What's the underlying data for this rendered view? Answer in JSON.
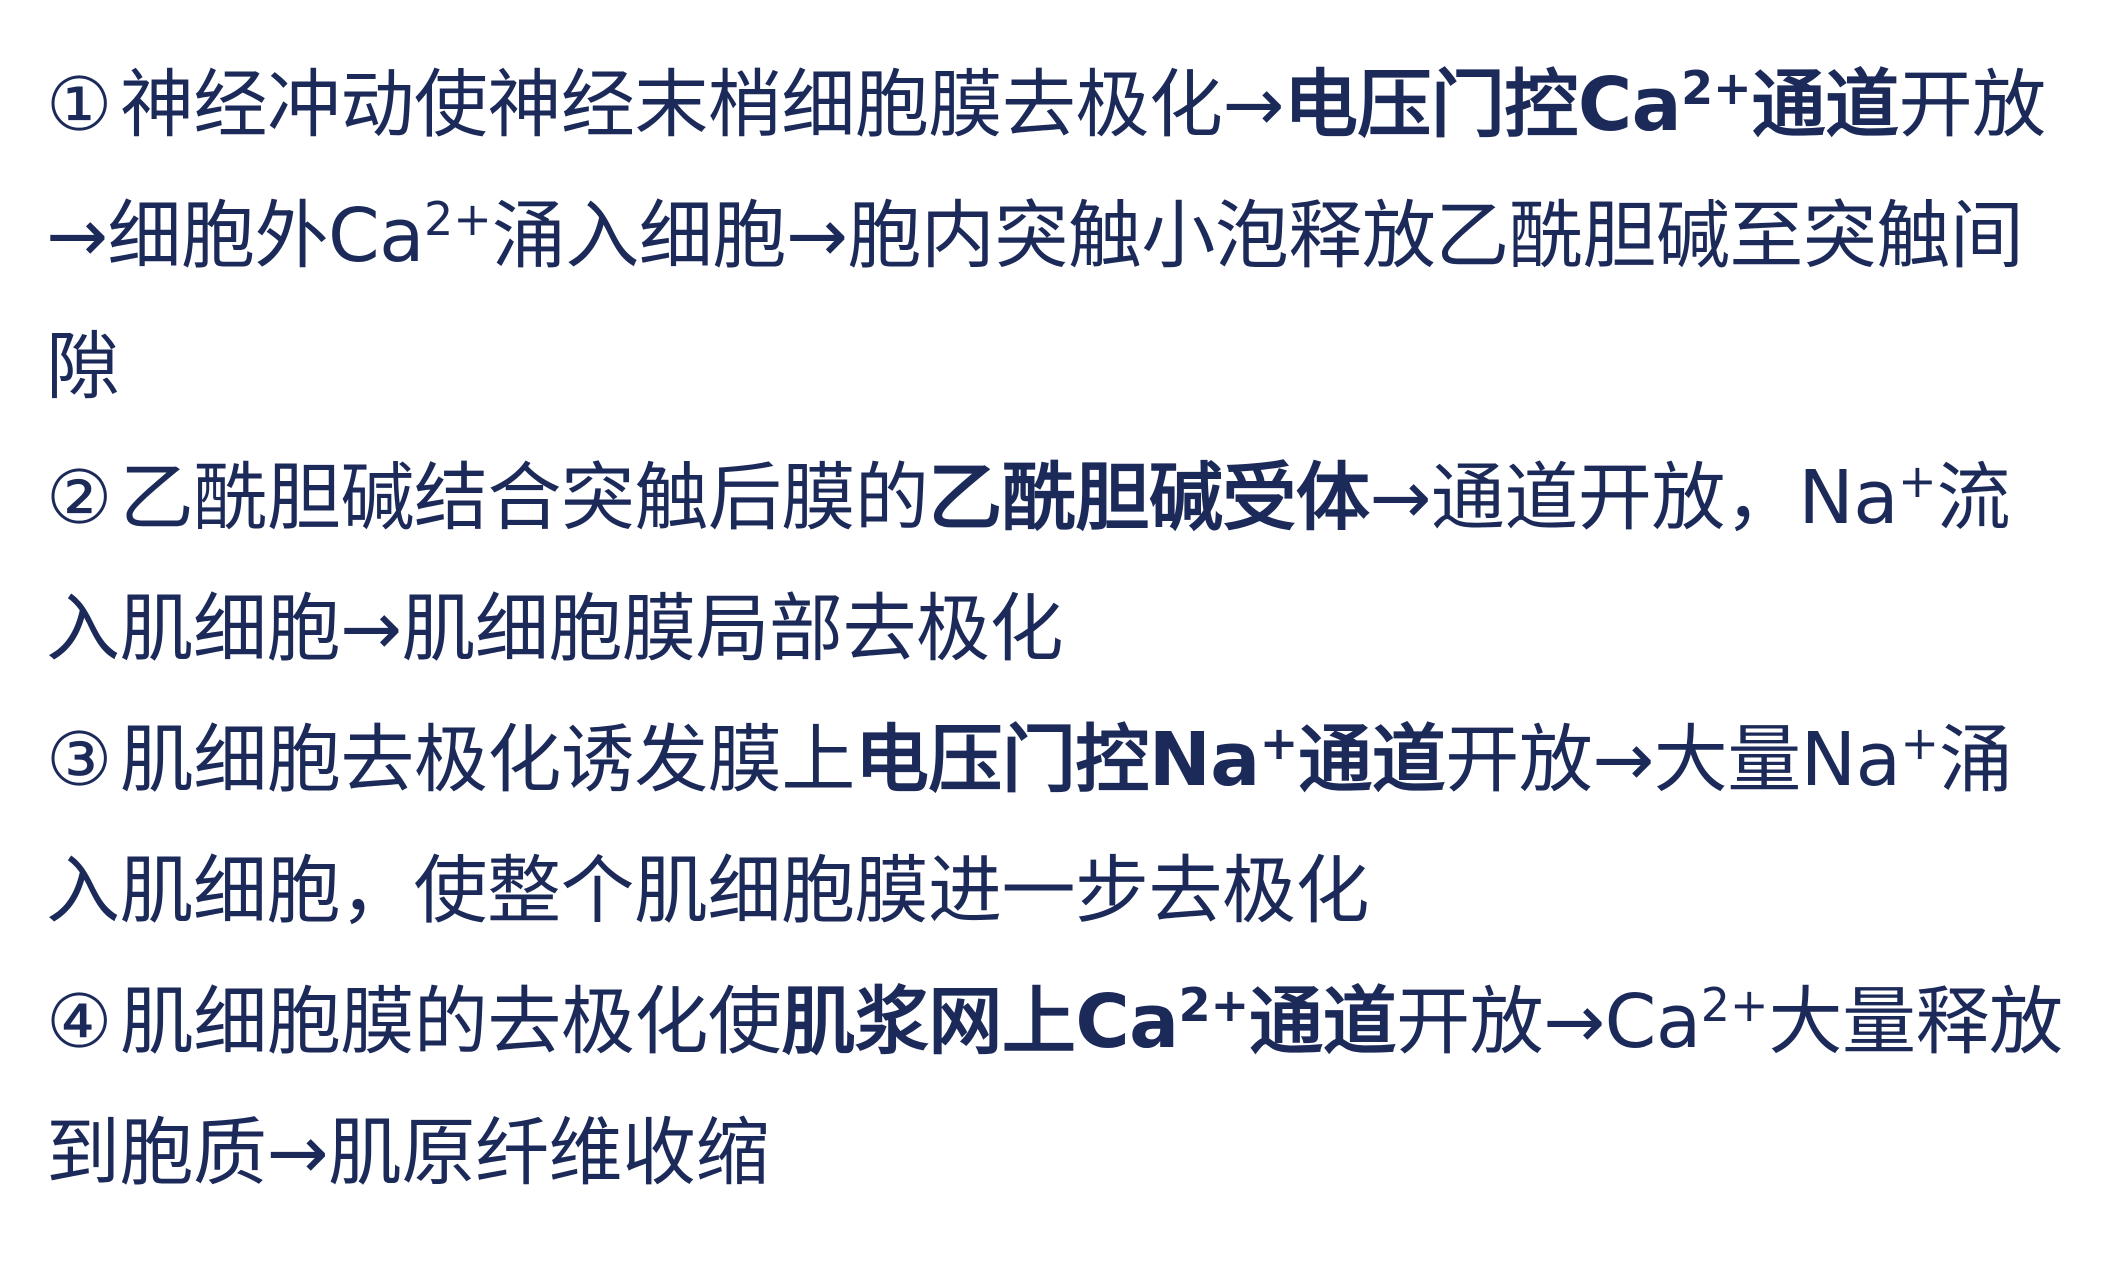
{
  "steps": [
    {
      "number": "①",
      "segments": [
        {
          "text": "神经冲动使神经末梢细胞膜去极化→"
        },
        {
          "text": "电压门控Ca",
          "bold": true
        },
        {
          "text": "2+",
          "bold": true,
          "sup": true
        },
        {
          "text": "通道",
          "bold": true
        },
        {
          "text": "开放→细胞外Ca"
        },
        {
          "text": "2+",
          "sup": true
        },
        {
          "text": "涌入细胞→胞内突触小泡释放乙酰胆碱至突触间隙"
        }
      ]
    },
    {
      "number": "②",
      "segments": [
        {
          "text": "乙酰胆碱结合突触后膜的"
        },
        {
          "text": "乙酰胆碱受体",
          "bold": true
        },
        {
          "text": "→通道开放，Na"
        },
        {
          "text": "+",
          "sup": true
        },
        {
          "text": "流入肌细胞→肌细胞膜局部去极化"
        }
      ]
    },
    {
      "number": "③",
      "segments": [
        {
          "text": "肌细胞去极化诱发膜上"
        },
        {
          "text": "电压门控Na",
          "bold": true
        },
        {
          "text": "+",
          "bold": true,
          "sup": true
        },
        {
          "text": "通道",
          "bold": true
        },
        {
          "text": "开放→大量Na"
        },
        {
          "text": "+",
          "sup": true
        },
        {
          "text": "涌入肌细胞，使整个肌细胞膜进一步去极化"
        }
      ]
    },
    {
      "number": "④",
      "segments": [
        {
          "text": "肌细胞膜的去极化使"
        },
        {
          "text": "肌浆网上Ca",
          "bold": true
        },
        {
          "text": "2+",
          "bold": true,
          "sup": true
        },
        {
          "text": "通道",
          "bold": true
        },
        {
          "text": "开放→Ca"
        },
        {
          "text": "2+",
          "sup": true
        },
        {
          "text": "大量释放到胞质→肌原纤维收缩"
        }
      ]
    }
  ],
  "colors": {
    "text": "#1c2a5a",
    "background": "#ffffff"
  }
}
